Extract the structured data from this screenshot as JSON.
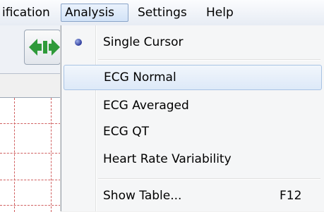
{
  "menubar": {
    "items": [
      {
        "label": "ification"
      },
      {
        "label": "Analysis"
      },
      {
        "label": "Settings"
      },
      {
        "label": "Help"
      }
    ]
  },
  "toolbar": {
    "button_icon": "green-arrows-icon",
    "icon_color": "#2e9a3a"
  },
  "dropdown": {
    "items": [
      {
        "label": "Single Cursor",
        "selected": true
      },
      {
        "label": "ECG Normal"
      },
      {
        "label": "ECG Averaged"
      },
      {
        "label": "ECG QT"
      },
      {
        "label": "Heart Rate Variability"
      },
      {
        "label": "Show Table...",
        "shortcut": "F12"
      }
    ]
  },
  "colors": {
    "highlight": "#dde9f8",
    "grid": "#d06060",
    "radio": "#2c3a9c"
  }
}
